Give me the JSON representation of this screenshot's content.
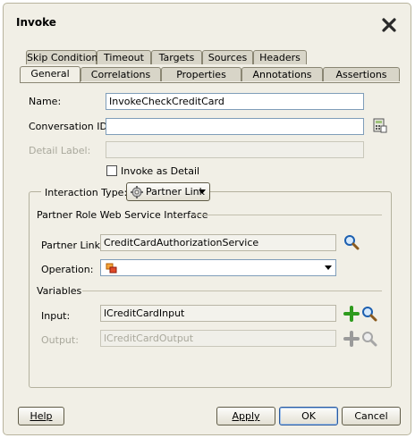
{
  "dialog": {
    "title": "Invoke"
  },
  "tabs": {
    "row1": [
      "Skip Condition",
      "Timeout",
      "Targets",
      "Sources",
      "Headers"
    ],
    "row2": [
      "General",
      "Correlations",
      "Properties",
      "Annotations",
      "Assertions"
    ],
    "active": "General"
  },
  "general": {
    "name_label": "Name:",
    "name_value": "InvokeCheckCreditCard",
    "conversation_label": "Conversation ID:",
    "conversation_value": "",
    "detail_label": "Detail Label:",
    "detail_value": "",
    "invoke_as_detail": "Invoke as Detail",
    "invoke_as_detail_checked": false,
    "interaction_type_label": "Interaction Type:",
    "interaction_type_value": "Partner Link",
    "partner_role_header": "Partner Role Web Service Interface",
    "partner_link_label": "Partner Link:",
    "partner_link_value": "CreditCardAuthorizationService",
    "operation_label": "Operation:",
    "operation_value": "",
    "variables_header": "Variables",
    "input_label": "Input:",
    "input_value": "lCreditCardInput",
    "output_label": "Output:",
    "output_value": "lCreditCardOutput"
  },
  "buttons": {
    "help": "Help",
    "apply": "Apply",
    "ok": "OK",
    "cancel": "Cancel"
  },
  "colors": {
    "dialog_bg": "#f1efe6",
    "tab_bg": "#d8d5c8",
    "field_border": "#7f9db9",
    "add_icon": "#2e9b1d",
    "search_icon": "#1c5fb0"
  }
}
